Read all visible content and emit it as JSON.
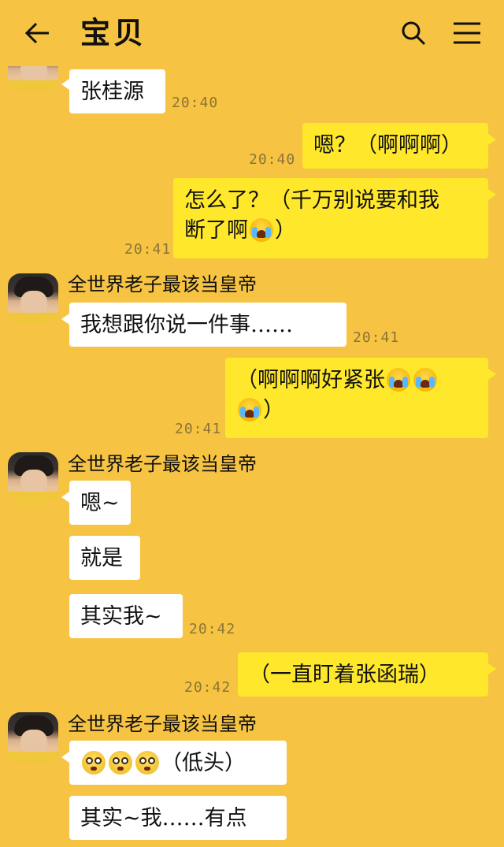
{
  "header": {
    "title": "宝贝",
    "back_icon": "arrow-left-icon",
    "search_icon": "search-icon",
    "menu_icon": "hamburger-menu-icon"
  },
  "colors": {
    "background": "#F7C342",
    "incoming_bubble": "#FFFFFF",
    "outgoing_bubble": "#FFE82B"
  },
  "messages": [
    {
      "id": "m1",
      "direction": "in",
      "text": "张桂源",
      "time": "20:40"
    },
    {
      "id": "m2",
      "direction": "out",
      "text": "嗯？（啊啊啊）",
      "time": "20:40"
    },
    {
      "id": "m3",
      "direction": "out",
      "text_line1": "怎么了？（千万别说要和我",
      "text_line2": "断了啊",
      "emoji": "crying-face",
      "time": "20:41"
    },
    {
      "id": "m4",
      "direction": "in",
      "sender": "全世界老子最该当皇帝",
      "text": "我想跟你说一件事……",
      "time": "20:41"
    },
    {
      "id": "m5",
      "direction": "out",
      "text": "（啊啊啊好紧张",
      "emoji_count": 3,
      "emoji": "crying-face",
      "text_end": "）",
      "time": "20:41"
    },
    {
      "id": "m6",
      "direction": "in",
      "sender": "全世界老子最该当皇帝",
      "text": "嗯~"
    },
    {
      "id": "m7",
      "direction": "in",
      "text": "就是"
    },
    {
      "id": "m8",
      "direction": "in",
      "text": "其实我~",
      "time": "20:42"
    },
    {
      "id": "m9",
      "direction": "out",
      "text": "（一直盯着张函瑞）",
      "time": "20:42"
    },
    {
      "id": "m10",
      "direction": "in",
      "sender": "全世界老子最该当皇帝",
      "emoji_count": 3,
      "emoji": "flushed-face",
      "text": "（低头）"
    },
    {
      "id": "m11",
      "direction": "in",
      "text": "其实~我……有点"
    }
  ]
}
